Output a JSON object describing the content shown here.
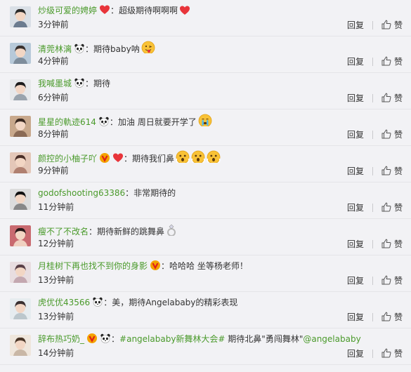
{
  "colors": {
    "username": "#4a9a2b",
    "background": "#f2f2f5",
    "heart": "#e8343a"
  },
  "labels": {
    "reply": "回复",
    "like": "赞"
  },
  "comments": [
    {
      "username": "炒级可爱的娉婷",
      "badges": [
        "heart-icon"
      ],
      "text": "超级期待啊啊啊",
      "text_emojis": [
        "heart-icon"
      ],
      "time": "3分钟前"
    },
    {
      "username": "清莞林漓",
      "badges": [
        "panda-icon"
      ],
      "text": "期待baby呐",
      "text_emojis": [
        "tongue-face-icon"
      ],
      "time": "4分钟前"
    },
    {
      "username": "我喊墨城",
      "badges": [
        "panda-icon"
      ],
      "text": "期待",
      "text_emojis": [],
      "time": "6分钟前"
    },
    {
      "username": "星星的軌迹614",
      "badges": [
        "panda-icon"
      ],
      "text": "加油 周日就要开学了",
      "text_emojis": [
        "crying-face-icon"
      ],
      "time": "8分钟前"
    },
    {
      "username": "颜控的小柚子吖",
      "badges": [
        "vip-icon",
        "heart-icon"
      ],
      "text": "期待我们鼻",
      "text_emojis": [
        "shocked-face-icon",
        "shocked-face-icon",
        "shocked-face-icon"
      ],
      "time": "9分钟前"
    },
    {
      "username": "godofshooting63386",
      "badges": [],
      "text": "非常期待的",
      "text_emojis": [],
      "time": "11分钟前"
    },
    {
      "username": "瘦不了不改名",
      "badges": [],
      "text": "期待新鲜的跳舞鼻",
      "text_emojis": [
        "ring-icon"
      ],
      "time": "12分钟前"
    },
    {
      "username": "月桂树下再也找不到你的身影",
      "badges": [
        "vip-icon"
      ],
      "text": "哈哈哈 坐等杨老师！",
      "text_emojis": [],
      "time": "13分钟前"
    },
    {
      "username": "虎优优43566",
      "badges": [
        "panda-icon"
      ],
      "text": "美，期待Angelababy的精彩表现",
      "text_emojis": [],
      "time": "13分钟前"
    },
    {
      "username": "辞布热巧奶_",
      "badges": [
        "vip-icon",
        "panda-icon"
      ],
      "text_hashtag": "#angelababy新舞林大会#",
      "text": " 期待北鼻\"勇闯舞林\"",
      "text_mention": "@angelababy",
      "text_emojis": [],
      "time": "14分钟前"
    }
  ]
}
